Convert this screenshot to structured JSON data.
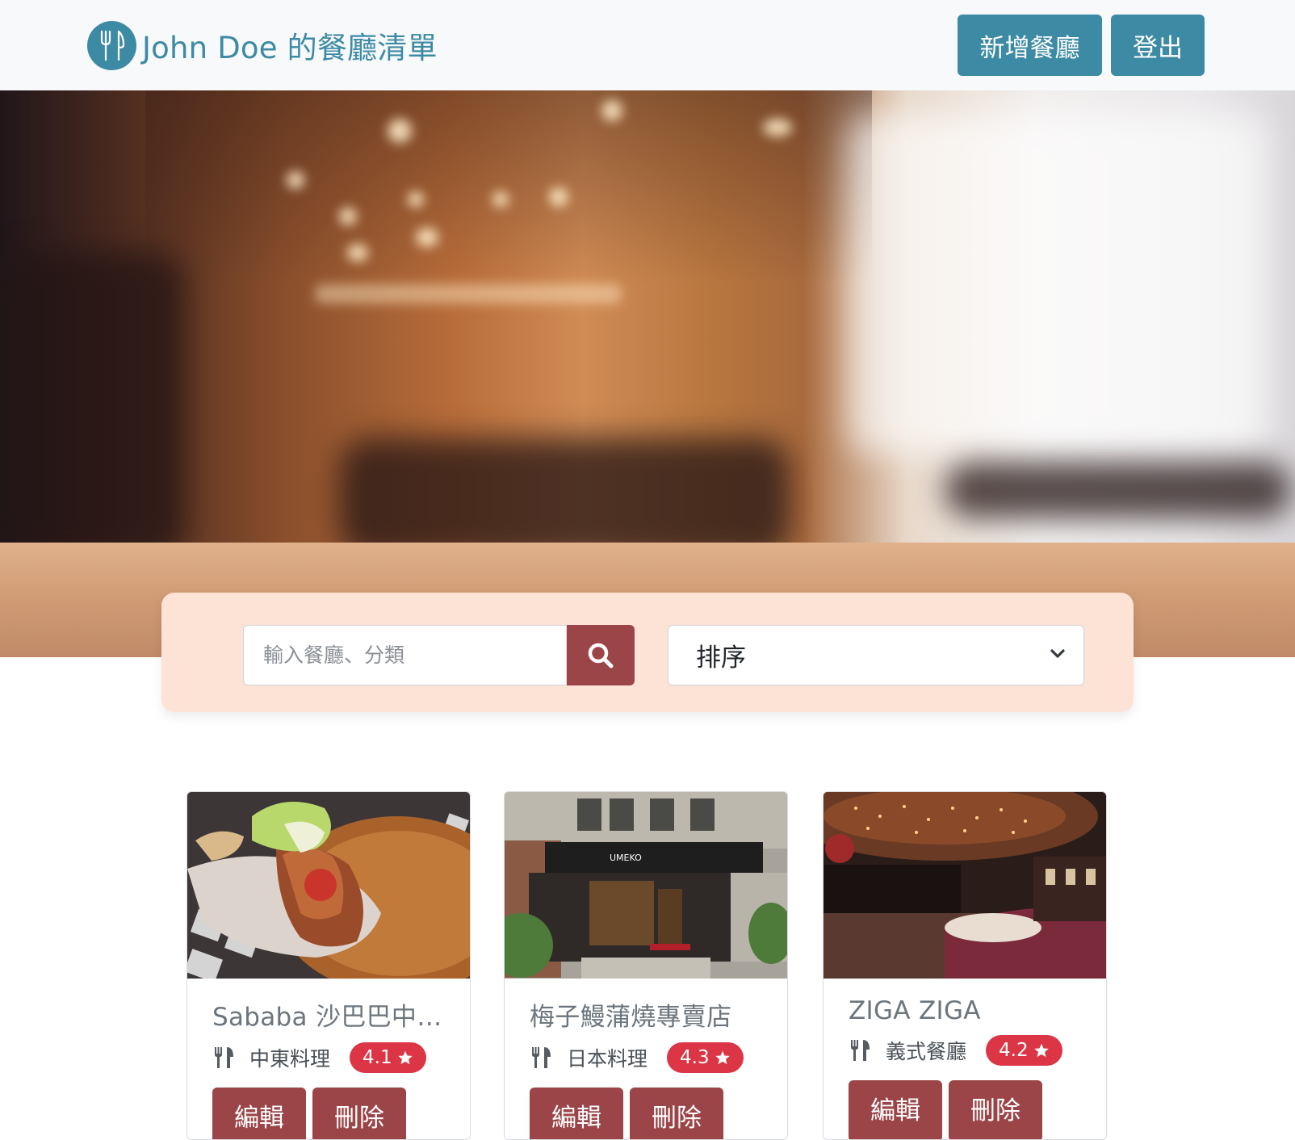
{
  "navbar": {
    "brand": "John Doe 的餐廳清單",
    "brand_icon": "utensils-icon",
    "add_label": "新增餐廳",
    "logout_label": "登出",
    "accent": "#3d8aa5"
  },
  "search": {
    "placeholder": "輸入餐廳、分類",
    "icon": "search-icon",
    "sort_label": "排序"
  },
  "colors": {
    "button": "#9b4548",
    "badge": "#dc3545",
    "search_bg": "#fde2d6"
  },
  "restaurants": [
    {
      "name": "Sababa 沙巴巴中東美食",
      "category": "中東料理",
      "rating": "4.1",
      "edit": "編輯",
      "delete": "刪除"
    },
    {
      "name": "梅子鰻蒲燒專賣店",
      "category": "日本料理",
      "rating": "4.3",
      "edit": "編輯",
      "delete": "刪除"
    },
    {
      "name": "ZIGA ZIGA",
      "category": "義式餐廳",
      "rating": "4.2",
      "edit": "編輯",
      "delete": "刪除"
    }
  ]
}
